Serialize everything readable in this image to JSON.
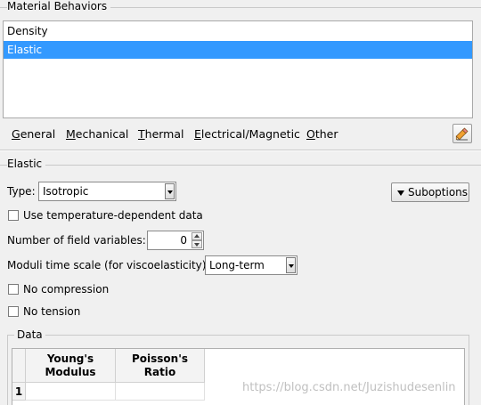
{
  "material_behaviors": {
    "title": "Material Behaviors",
    "items": [
      {
        "label": "Density",
        "selected": false
      },
      {
        "label": "Elastic",
        "selected": true
      }
    ]
  },
  "menubar": [
    {
      "label": "General",
      "underline": "G",
      "rest": "eneral"
    },
    {
      "label": "Mechanical",
      "underline": "M",
      "rest": "echanical"
    },
    {
      "label": "Thermal",
      "underline": "T",
      "rest": "hermal"
    },
    {
      "label": "Electrical/Magnetic",
      "underline": "E",
      "rest": "lectrical/Magnetic"
    },
    {
      "label": "Other",
      "underline": "O",
      "rest": "ther"
    }
  ],
  "edit_icon": "pencil-eraser-icon",
  "elastic": {
    "section_title": "Elastic",
    "type_label": "Type:",
    "type_value": "Isotropic",
    "suboptions_label": "Suboptions",
    "use_temp_label": "Use temperature-dependent data",
    "use_temp_checked": false,
    "num_field_vars_label": "Number of field variables:",
    "num_field_vars_value": "0",
    "moduli_label": "Moduli time scale (for viscoelasticity):",
    "moduli_value": "Long-term",
    "no_compression_label": "No compression",
    "no_compression_checked": false,
    "no_tension_label": "No tension",
    "no_tension_checked": false
  },
  "data": {
    "title": "Data",
    "columns": [
      {
        "line1": "Young's",
        "line2": "Modulus"
      },
      {
        "line1": "Poisson's",
        "line2": "Ratio"
      }
    ],
    "rows": [
      {
        "index": "1",
        "values": [
          "",
          ""
        ]
      }
    ]
  },
  "watermark": "https://blog.csdn.net/Juzishudesenlin",
  "colors": {
    "selection": "#3399ff",
    "background": "#f0f0f0"
  }
}
